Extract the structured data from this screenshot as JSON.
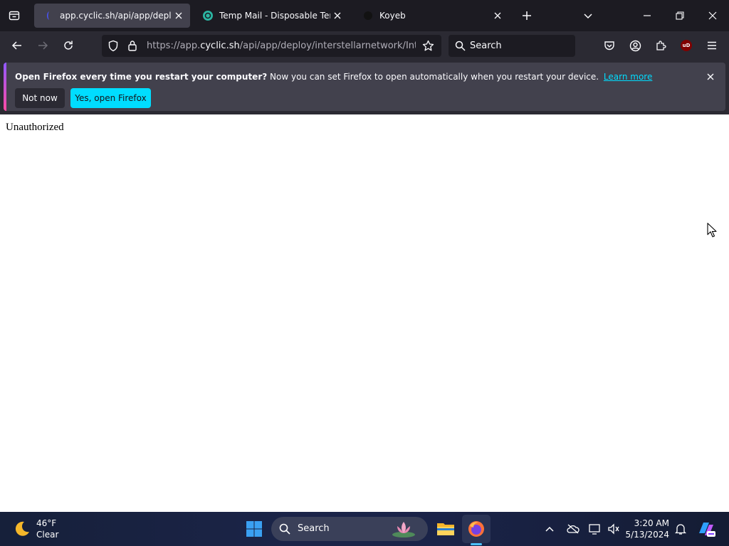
{
  "browser": {
    "tabs": [
      {
        "title": "app.cyclic.sh/api/app/deploy/i",
        "active": true
      },
      {
        "title": "Temp Mail - Disposable Tempo",
        "active": false
      },
      {
        "title": "Koyeb",
        "active": false
      }
    ],
    "url": {
      "prefix": "https://app.",
      "host": "cyclic.sh",
      "path": "/api/app/deploy/interstellarnetwork/Interst"
    },
    "search_placeholder": "Search",
    "ublock_badge": "uD"
  },
  "notification": {
    "title": "Open Firefox every time you restart your computer?",
    "message": "Now you can set Firefox to open automatically when you restart your device.",
    "link": "Learn more",
    "btn_not_now": "Not now",
    "btn_yes": "Yes, open Firefox"
  },
  "page": {
    "body_text": "Unauthorized"
  },
  "taskbar": {
    "weather_temp": "46°F",
    "weather_desc": "Clear",
    "search_label": "Search",
    "time": "3:20 AM",
    "date": "5/13/2024"
  },
  "colors": {
    "accent": "#00ddff",
    "tab_active": "#42414d",
    "toolbar": "#2b2a33",
    "tabbar": "#1c1b22"
  }
}
